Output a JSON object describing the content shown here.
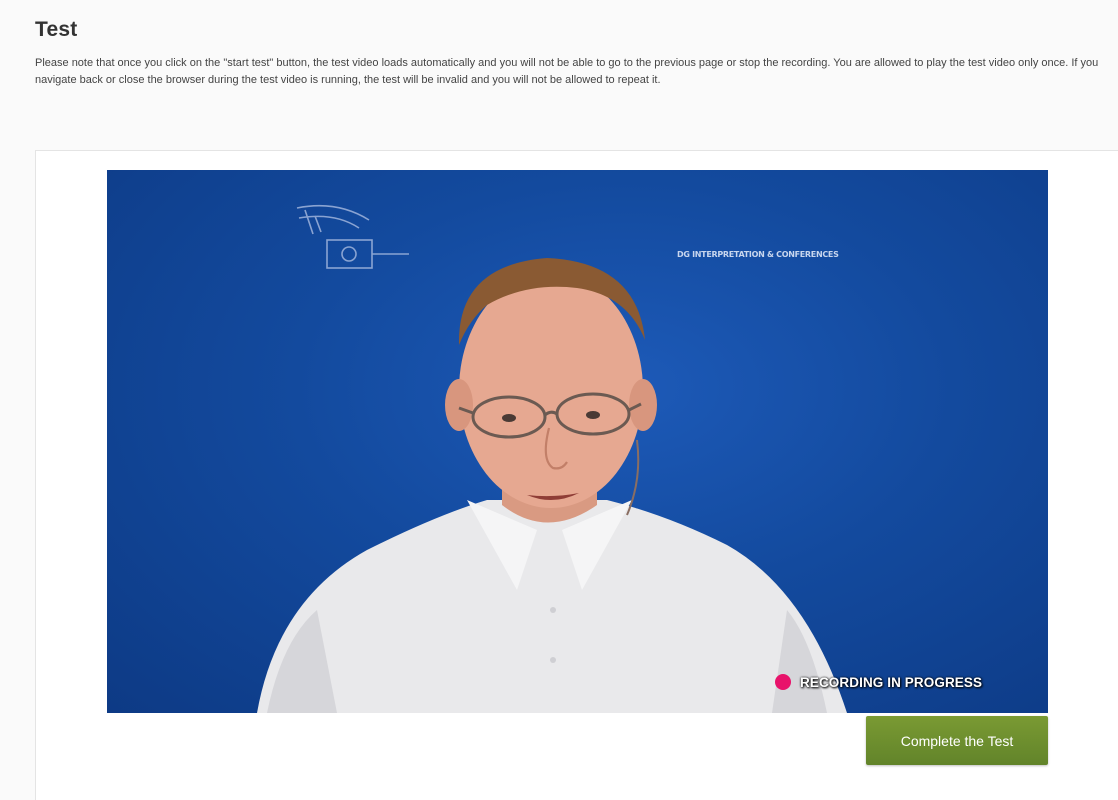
{
  "page": {
    "title": "Test",
    "intro": "Please note that once you click on the \"start test\" button, the test video loads automatically and you will not be able to go to the previous page or stop the recording. You are allowed to play the test video only once. If you navigate back or close the browser during the test video is running, the test will be invalid and you will not be allowed to repeat it."
  },
  "video": {
    "overlay_text": "DG INTERPRETATION & CONFERENCES",
    "recording_label": "RECORDING IN PROGRESS",
    "recording_color": "#e8136b",
    "background_color": "#134a9e"
  },
  "actions": {
    "complete_label": "Complete the Test",
    "complete_color": "#6f8f2e"
  }
}
